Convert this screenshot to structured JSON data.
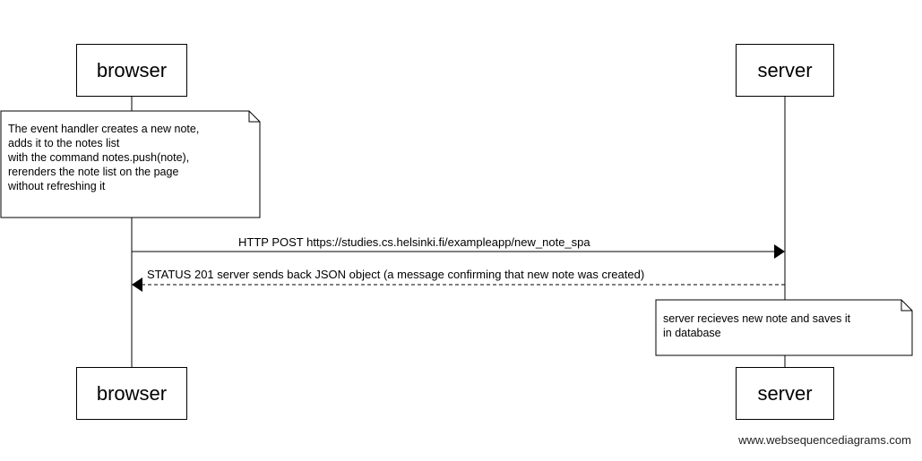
{
  "participants": {
    "browser": {
      "name": "browser"
    },
    "server": {
      "name": "server"
    }
  },
  "notes": {
    "browser_note": {
      "lines": [
        "The event handler creates a new note,",
        "adds it to the notes list",
        "with the command notes.push(note),",
        "rerenders the note list on the page",
        "without refreshing it"
      ]
    },
    "server_note": {
      "lines": [
        "server recieves new note and saves it",
        "in database"
      ]
    }
  },
  "messages": [
    {
      "from": "browser",
      "to": "server",
      "style": "solid",
      "label": "HTTP POST https://studies.cs.helsinki.fi/exampleapp/new_note_spa"
    },
    {
      "from": "server",
      "to": "browser",
      "style": "dashed",
      "label": "STATUS 201 server sends back JSON object (a message confirming that new note was created)"
    }
  ],
  "watermark": "www.websequencediagrams.com",
  "colors": {
    "line": "#000000",
    "background": "#ffffff"
  }
}
